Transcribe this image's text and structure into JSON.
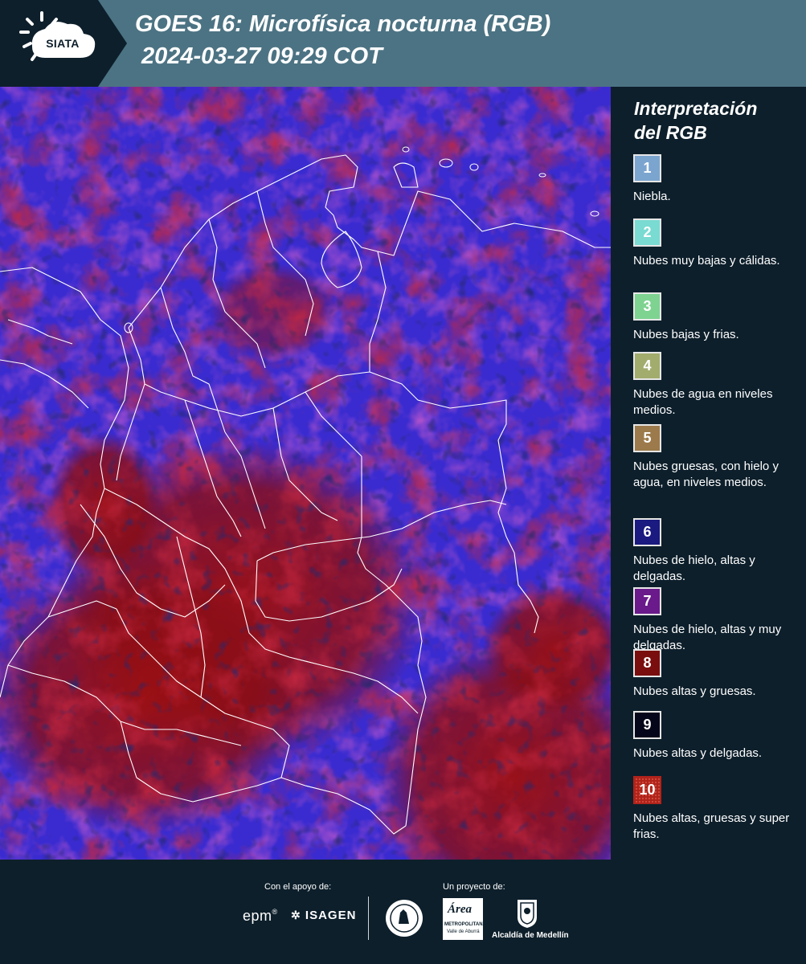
{
  "header": {
    "logo_text": "SIATA",
    "title_line1": "GOES 16: Microfísica nocturna (RGB)",
    "title_line2": "2024-03-27 09:29 COT"
  },
  "legend": {
    "title_line1": "Interpretación",
    "title_line2": "del RGB",
    "items": [
      {
        "number": "1",
        "label": "Niebla.",
        "color": "#7ba5cf"
      },
      {
        "number": "2",
        "label": "Nubes muy bajas y cálidas.",
        "color": "#79dbd2"
      },
      {
        "number": "3",
        "label": "Nubes bajas y frias.",
        "color": "#7ed391"
      },
      {
        "number": "4",
        "label": "Nubes de agua en niveles medios.",
        "color": "#a2ac6d"
      },
      {
        "number": "5",
        "label": "Nubes gruesas, con hielo y agua, en niveles medios.",
        "color": "#9c7a4c"
      },
      {
        "number": "6",
        "label": "Nubes de hielo, altas y delgadas.",
        "color": "#1a1a80"
      },
      {
        "number": "7",
        "label": "Nubes de hielo, altas y muy delgadas.",
        "color": "#6a1a8a"
      },
      {
        "number": "8",
        "label": "Nubes altas y gruesas.",
        "color": "#7a0e0e"
      },
      {
        "number": "9",
        "label": "Nubes altas y delgadas.",
        "color": "#06061a"
      },
      {
        "number": "10",
        "label": "Nubes altas, gruesas y super frias.",
        "color": "#b0231b"
      }
    ]
  },
  "footer": {
    "support_caption": "Con el apoyo de:",
    "project_caption": "Un proyecto de:",
    "epm": "epm",
    "isagen": "ISAGEN",
    "area_metropolitana": "Área",
    "area_sub": "METROPOLITANA",
    "area_sub2": "Valle de Aburrá",
    "alcaldia": "Alcaldía de Medellín"
  },
  "colors": {
    "header_bg": "#4c7383",
    "panel_bg": "#0d1f2b",
    "map_blue": "#3a2bd0",
    "map_red": "#8e0f12",
    "map_purple": "#8a3aa8",
    "border_lines": "#ffffff"
  }
}
